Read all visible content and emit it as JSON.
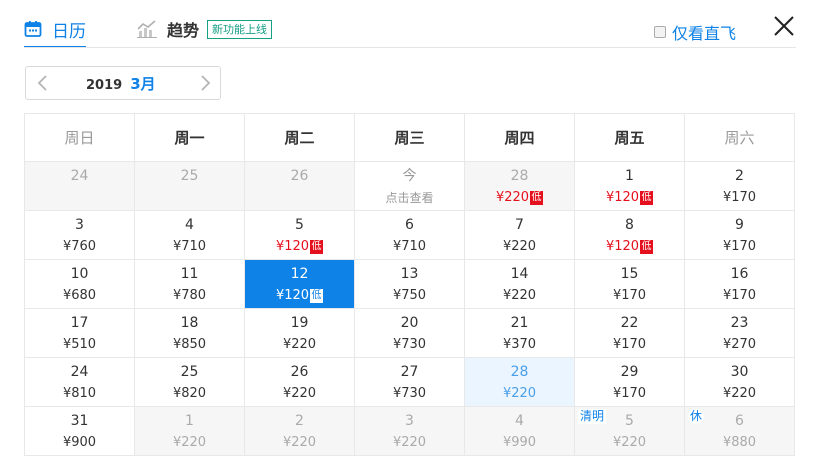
{
  "tabs": {
    "calendar": {
      "label": "日历"
    },
    "trend": {
      "label": "趋势",
      "badge": "新功能上线"
    }
  },
  "filter": {
    "direct_only_label": "仅看直飞",
    "checked": false
  },
  "month_nav": {
    "year": "2019",
    "month": "3月"
  },
  "weekdays": [
    "周日",
    "周一",
    "周二",
    "周三",
    "周四",
    "周五",
    "周六"
  ],
  "colors": {
    "accent": "#0e82e6",
    "low_price": "#e5101d",
    "selected_bg": "#0e82e6",
    "highlight_bg": "#eaf5ff"
  },
  "low_tag": "低",
  "calendar": {
    "rows": [
      {
        "cells": [
          {
            "day": "24",
            "price": "",
            "state": "muted"
          },
          {
            "day": "25",
            "price": "",
            "state": "muted"
          },
          {
            "day": "26",
            "price": "",
            "state": "muted"
          },
          {
            "day": "今",
            "price": "点击查看",
            "state": "today"
          },
          {
            "day": "28",
            "price": "¥220",
            "state": "muted-low"
          },
          {
            "day": "1",
            "price": "¥120",
            "state": "low"
          },
          {
            "day": "2",
            "price": "¥170",
            "state": ""
          }
        ]
      },
      {
        "cells": [
          {
            "day": "3",
            "price": "¥760",
            "state": ""
          },
          {
            "day": "4",
            "price": "¥710",
            "state": ""
          },
          {
            "day": "5",
            "price": "¥120",
            "state": "low"
          },
          {
            "day": "6",
            "price": "¥710",
            "state": ""
          },
          {
            "day": "7",
            "price": "¥220",
            "state": ""
          },
          {
            "day": "8",
            "price": "¥120",
            "state": "low"
          },
          {
            "day": "9",
            "price": "¥170",
            "state": ""
          }
        ]
      },
      {
        "cells": [
          {
            "day": "10",
            "price": "¥680",
            "state": ""
          },
          {
            "day": "11",
            "price": "¥780",
            "state": ""
          },
          {
            "day": "12",
            "price": "¥120",
            "state": "selected"
          },
          {
            "day": "13",
            "price": "¥750",
            "state": ""
          },
          {
            "day": "14",
            "price": "¥220",
            "state": ""
          },
          {
            "day": "15",
            "price": "¥170",
            "state": ""
          },
          {
            "day": "16",
            "price": "¥170",
            "state": ""
          }
        ]
      },
      {
        "cells": [
          {
            "day": "17",
            "price": "¥510",
            "state": ""
          },
          {
            "day": "18",
            "price": "¥850",
            "state": ""
          },
          {
            "day": "19",
            "price": "¥220",
            "state": ""
          },
          {
            "day": "20",
            "price": "¥730",
            "state": ""
          },
          {
            "day": "21",
            "price": "¥370",
            "state": ""
          },
          {
            "day": "22",
            "price": "¥170",
            "state": ""
          },
          {
            "day": "23",
            "price": "¥270",
            "state": ""
          }
        ]
      },
      {
        "cells": [
          {
            "day": "24",
            "price": "¥810",
            "state": ""
          },
          {
            "day": "25",
            "price": "¥820",
            "state": ""
          },
          {
            "day": "26",
            "price": "¥220",
            "state": ""
          },
          {
            "day": "27",
            "price": "¥730",
            "state": ""
          },
          {
            "day": "28",
            "price": "¥220",
            "state": "highlight"
          },
          {
            "day": "29",
            "price": "¥170",
            "state": ""
          },
          {
            "day": "30",
            "price": "¥220",
            "state": ""
          }
        ]
      },
      {
        "cells": [
          {
            "day": "31",
            "price": "¥900",
            "state": ""
          },
          {
            "day": "1",
            "price": "¥220",
            "state": "muted"
          },
          {
            "day": "2",
            "price": "¥220",
            "state": "muted"
          },
          {
            "day": "3",
            "price": "¥220",
            "state": "muted"
          },
          {
            "day": "4",
            "price": "¥990",
            "state": "muted"
          },
          {
            "day": "5",
            "price": "¥220",
            "state": "muted",
            "tag": "清明"
          },
          {
            "day": "6",
            "price": "¥880",
            "state": "muted",
            "tag": "休"
          }
        ]
      }
    ]
  }
}
